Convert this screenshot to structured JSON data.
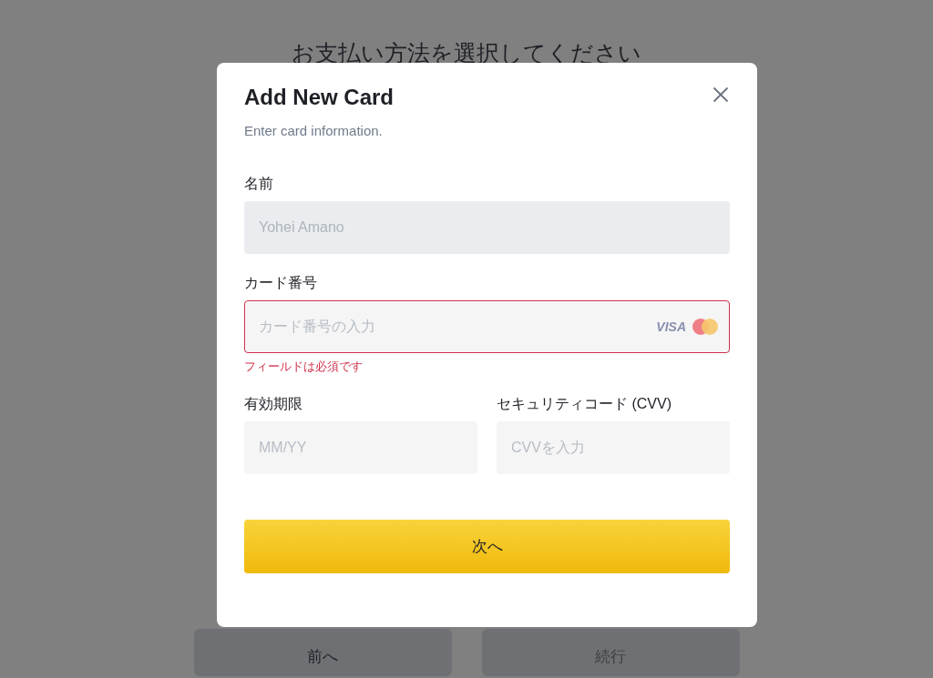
{
  "page": {
    "heading": "お支払い方法を選択してください",
    "buttons": [
      {
        "label": "前へ",
        "disabled": false
      },
      {
        "label": "続行",
        "disabled": true
      }
    ]
  },
  "dialog": {
    "title": "Add New Card",
    "subtitle": "Enter card information.",
    "rows": [
      [
        {
          "label": "名前",
          "value": "Yohei Amano",
          "disabled": true
        }
      ],
      [
        {
          "label": "カード番号",
          "placeholder": "カード番号の入力",
          "error": "フィールドは必須です",
          "card_brand": "VISA"
        }
      ],
      [
        {
          "label": "有効期限",
          "placeholder": "MM/YY"
        },
        {
          "label": "セキュリティコード (CVV)",
          "placeholder": "CVVを入力"
        }
      ]
    ],
    "submit": "次へ"
  }
}
